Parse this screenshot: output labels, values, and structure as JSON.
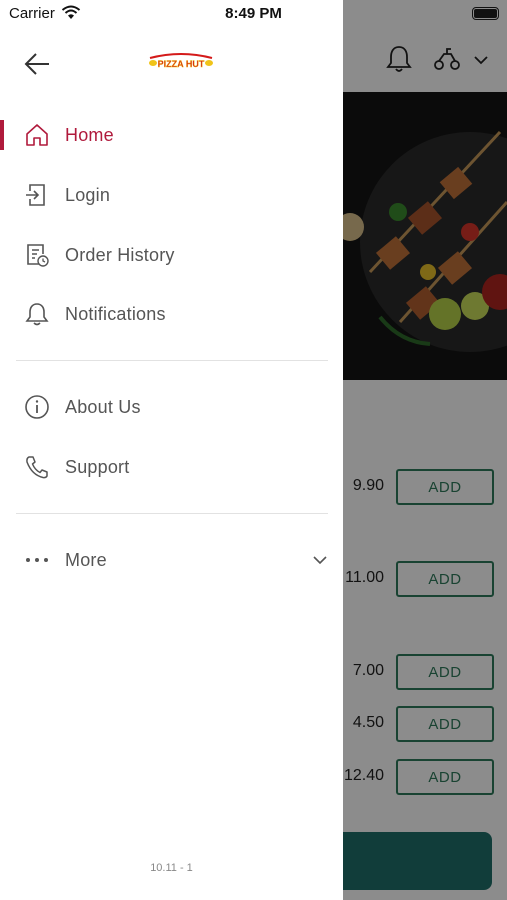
{
  "status_bar": {
    "carrier": "Carrier",
    "time": "8:49 PM"
  },
  "drawer": {
    "logo_text": "PIZZA HUT",
    "items": [
      {
        "label": "Home",
        "icon": "home-icon",
        "active": true
      },
      {
        "label": "Login",
        "icon": "login-icon"
      },
      {
        "label": "Order History",
        "icon": "order-history-icon"
      },
      {
        "label": "Notifications",
        "icon": "bell-icon"
      },
      {
        "label": "About Us",
        "icon": "info-icon"
      },
      {
        "label": "Support",
        "icon": "phone-icon"
      },
      {
        "label": "More",
        "icon": "more-dots-icon"
      }
    ],
    "version": "10.11 - 1",
    "accent": "#b01a3c"
  },
  "background": {
    "prices": [
      "9.90",
      "11.00",
      "7.00",
      "4.50",
      "12.40"
    ],
    "add_label": "ADD",
    "accent": "#2f7a5b"
  }
}
